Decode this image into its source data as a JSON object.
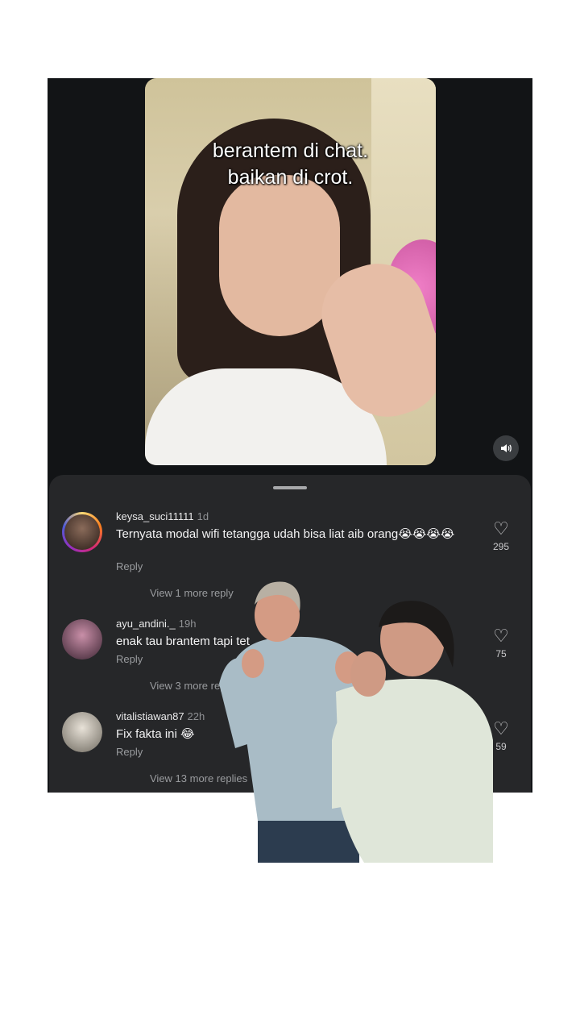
{
  "video": {
    "caption": "berantem di chat.\nbaikan di crot.",
    "sound_icon": "speaker-icon"
  },
  "comments": [
    {
      "username": "keysa_suci11111",
      "time": "1d",
      "text": "Ternyata modal wifi tetangga udah bisa liat aib orang😭😭😭😭",
      "reply_label": "Reply",
      "likes": "295",
      "view_more": "View 1 more reply"
    },
    {
      "username": "ayu_andini._",
      "time": "19h",
      "text": "enak tau brantem tapi tet",
      "reply_label": "Reply",
      "likes": "75",
      "view_more": "View 3 more rep"
    },
    {
      "username": "vitalistiawan87",
      "time": "22h",
      "text": "Fix fakta ini 😂",
      "reply_label": "Reply",
      "likes": "59",
      "view_more": "View 13 more replies"
    }
  ],
  "icons": {
    "like": "heart-icon"
  }
}
